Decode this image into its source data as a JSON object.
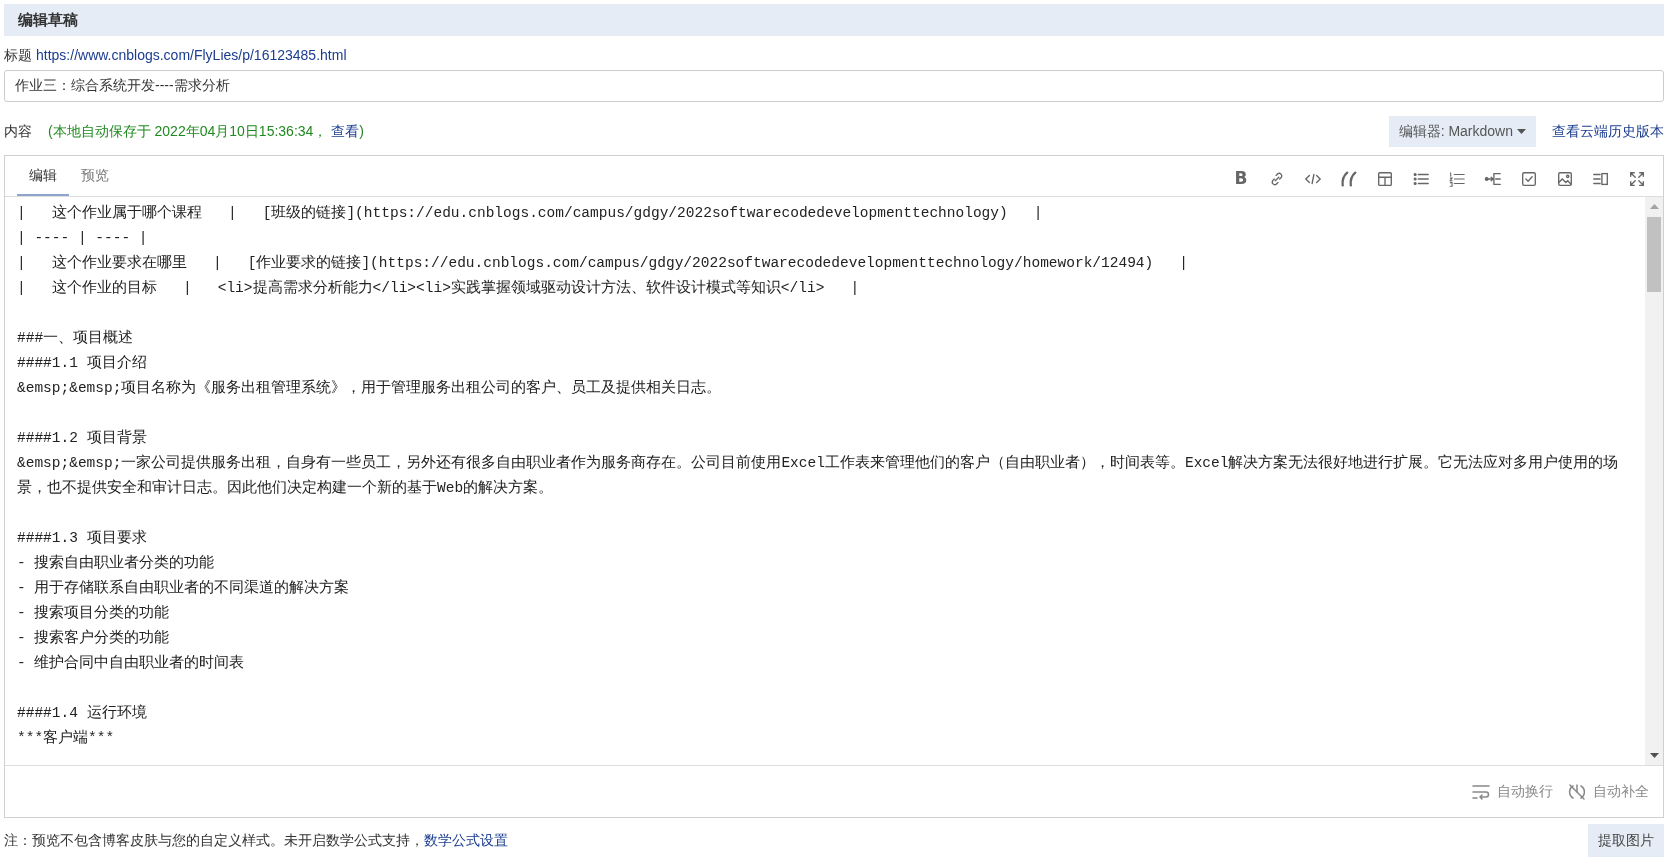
{
  "header": {
    "title": "编辑草稿"
  },
  "title_field": {
    "label": "标题",
    "link": "https://www.cnblogs.com/FlyLies/p/16123485.html",
    "value": "作业三：综合系统开发----需求分析"
  },
  "content_row": {
    "label": "内容",
    "autosave_prefix": "(本地自动保存于 2022年04月10日15:36:34，",
    "autosave_link": "查看",
    "autosave_suffix": ")",
    "editor_dropdown": "编辑器: Markdown",
    "history_link": "查看云端历史版本"
  },
  "editor": {
    "tabs": [
      {
        "label": "编辑",
        "selected": true
      },
      {
        "label": "预览",
        "selected": false
      }
    ],
    "toolbar": [
      {
        "kind": "bold",
        "label": "B"
      },
      {
        "kind": "link"
      },
      {
        "kind": "code"
      },
      {
        "kind": "quote"
      },
      {
        "kind": "table"
      },
      {
        "kind": "bullet-list"
      },
      {
        "kind": "number-list"
      },
      {
        "kind": "indent"
      },
      {
        "kind": "task"
      },
      {
        "kind": "image"
      },
      {
        "kind": "split"
      },
      {
        "kind": "fullscreen"
      }
    ],
    "paragraphs": [
      [
        "|   这个作业属于哪个课程   |   [班级的链接](https://edu.cnblogs.com/campus/gdgy/2022softwarecodedevelopmenttechnology)   |",
        "| ---- | ---- |",
        "|   这个作业要求在哪里   |   [作业要求的链接](https://edu.cnblogs.com/campus/gdgy/2022softwarecodedevelopmenttechnology/homework/12494)   |",
        "|   这个作业的目标   |   <li>提高需求分析能力</li><li>实践掌握领域驱动设计方法、软件设计模式等知识</li>   |"
      ],
      [
        "###一、项目概述",
        "####1.1 项目介绍",
        "&emsp;&emsp;项目名称为《服务出租管理系统》，用于管理服务出租公司的客户、员工及提供相关日志。"
      ],
      [
        "####1.2 项目背景",
        "&emsp;&emsp;一家公司提供服务出租，自身有一些员工，另外还有很多自由职业者作为服务商存在。公司目前使用Excel工作表来管理他们的客户（自由职业者），时间表等。Excel解决方案无法很好地进行扩展。它无法应对多用户使用的场景，也不提供安全和审计日志。因此他们决定构建一个新的基于Web的解决方案。"
      ],
      [
        "####1.3 项目要求",
        "- 搜索自由职业者分类的功能",
        "- 用于存储联系自由职业者的不同渠道的解决方案",
        "- 搜索项目分类的功能",
        "- 搜索客户分类的功能",
        "- 维护合同中自由职业者的时间表"
      ],
      [
        "####1.4 运行环境",
        "***客户端***"
      ]
    ],
    "options": [
      {
        "kind": "wrap",
        "label": "自动换行",
        "on": true
      },
      {
        "kind": "autocomplete",
        "label": "自动补全",
        "on": false
      }
    ]
  },
  "footer": {
    "note": "注：预览不包含博客皮肤与您的自定义样式。未开启数学公式支持，",
    "link": "数学公式设置",
    "button": "提取图片"
  }
}
